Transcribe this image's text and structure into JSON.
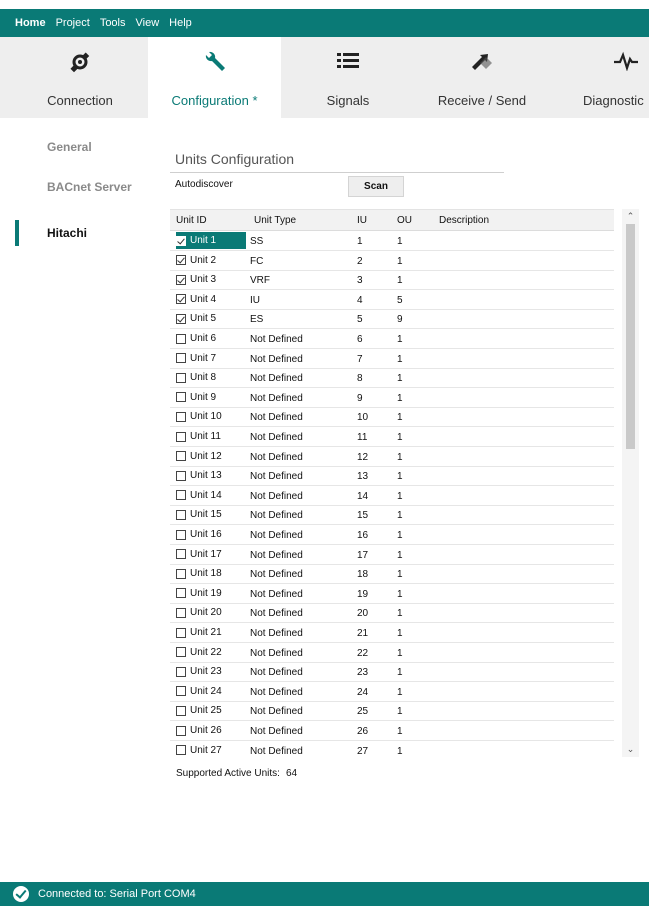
{
  "menu": [
    "Home",
    "Project",
    "Tools",
    "View",
    "Help"
  ],
  "ribbon": {
    "tabs": [
      {
        "label": "Connection",
        "icon": "plug-icon"
      },
      {
        "label": "Configuration *",
        "icon": "wrench-icon"
      },
      {
        "label": "Signals",
        "icon": "list-icon"
      },
      {
        "label": "Receive / Send",
        "icon": "arrows-icon"
      },
      {
        "label": "Diagnostic",
        "icon": "waveform-icon"
      }
    ]
  },
  "nav": {
    "items": [
      "General",
      "BACnet Server",
      "Hitachi"
    ],
    "active": "Hitachi"
  },
  "content": {
    "title": "Units Configuration",
    "autodiscover_label": "Autodiscover",
    "scan_label": "Scan",
    "columns": [
      "Unit ID",
      "Unit Type",
      "IU",
      "OU",
      "Description"
    ],
    "rows": [
      {
        "id": "Unit 1",
        "checked": true,
        "type": "SS",
        "iu": "1",
        "ou": "1",
        "desc": ""
      },
      {
        "id": "Unit 2",
        "checked": true,
        "type": "FC",
        "iu": "2",
        "ou": "1",
        "desc": ""
      },
      {
        "id": "Unit 3",
        "checked": true,
        "type": "VRF",
        "iu": "3",
        "ou": "1",
        "desc": ""
      },
      {
        "id": "Unit 4",
        "checked": true,
        "type": "IU",
        "iu": "4",
        "ou": "5",
        "desc": ""
      },
      {
        "id": "Unit 5",
        "checked": true,
        "type": "ES",
        "iu": "5",
        "ou": "9",
        "desc": ""
      },
      {
        "id": "Unit 6",
        "checked": false,
        "type": "Not Defined",
        "iu": "6",
        "ou": "1",
        "desc": ""
      },
      {
        "id": "Unit 7",
        "checked": false,
        "type": "Not Defined",
        "iu": "7",
        "ou": "1",
        "desc": ""
      },
      {
        "id": "Unit 8",
        "checked": false,
        "type": "Not Defined",
        "iu": "8",
        "ou": "1",
        "desc": ""
      },
      {
        "id": "Unit 9",
        "checked": false,
        "type": "Not Defined",
        "iu": "9",
        "ou": "1",
        "desc": ""
      },
      {
        "id": "Unit 10",
        "checked": false,
        "type": "Not Defined",
        "iu": "10",
        "ou": "1",
        "desc": ""
      },
      {
        "id": "Unit 11",
        "checked": false,
        "type": "Not Defined",
        "iu": "11",
        "ou": "1",
        "desc": ""
      },
      {
        "id": "Unit 12",
        "checked": false,
        "type": "Not Defined",
        "iu": "12",
        "ou": "1",
        "desc": ""
      },
      {
        "id": "Unit 13",
        "checked": false,
        "type": "Not Defined",
        "iu": "13",
        "ou": "1",
        "desc": ""
      },
      {
        "id": "Unit 14",
        "checked": false,
        "type": "Not Defined",
        "iu": "14",
        "ou": "1",
        "desc": ""
      },
      {
        "id": "Unit 15",
        "checked": false,
        "type": "Not Defined",
        "iu": "15",
        "ou": "1",
        "desc": ""
      },
      {
        "id": "Unit 16",
        "checked": false,
        "type": "Not Defined",
        "iu": "16",
        "ou": "1",
        "desc": ""
      },
      {
        "id": "Unit 17",
        "checked": false,
        "type": "Not Defined",
        "iu": "17",
        "ou": "1",
        "desc": ""
      },
      {
        "id": "Unit 18",
        "checked": false,
        "type": "Not Defined",
        "iu": "18",
        "ou": "1",
        "desc": ""
      },
      {
        "id": "Unit 19",
        "checked": false,
        "type": "Not Defined",
        "iu": "19",
        "ou": "1",
        "desc": ""
      },
      {
        "id": "Unit 20",
        "checked": false,
        "type": "Not Defined",
        "iu": "20",
        "ou": "1",
        "desc": ""
      },
      {
        "id": "Unit 21",
        "checked": false,
        "type": "Not Defined",
        "iu": "21",
        "ou": "1",
        "desc": ""
      },
      {
        "id": "Unit 22",
        "checked": false,
        "type": "Not Defined",
        "iu": "22",
        "ou": "1",
        "desc": ""
      },
      {
        "id": "Unit 23",
        "checked": false,
        "type": "Not Defined",
        "iu": "23",
        "ou": "1",
        "desc": ""
      },
      {
        "id": "Unit 24",
        "checked": false,
        "type": "Not Defined",
        "iu": "24",
        "ou": "1",
        "desc": ""
      },
      {
        "id": "Unit 25",
        "checked": false,
        "type": "Not Defined",
        "iu": "25",
        "ou": "1",
        "desc": ""
      },
      {
        "id": "Unit 26",
        "checked": false,
        "type": "Not Defined",
        "iu": "26",
        "ou": "1",
        "desc": ""
      },
      {
        "id": "Unit 27",
        "checked": false,
        "type": "Not Defined",
        "iu": "27",
        "ou": "1",
        "desc": ""
      }
    ],
    "supported_label": "Supported Active Units:",
    "supported_value": "64"
  },
  "status": {
    "text": "Connected to: Serial Port COM4",
    "icon": "check-circle-icon"
  },
  "colors": {
    "accent": "#0a7a76"
  }
}
